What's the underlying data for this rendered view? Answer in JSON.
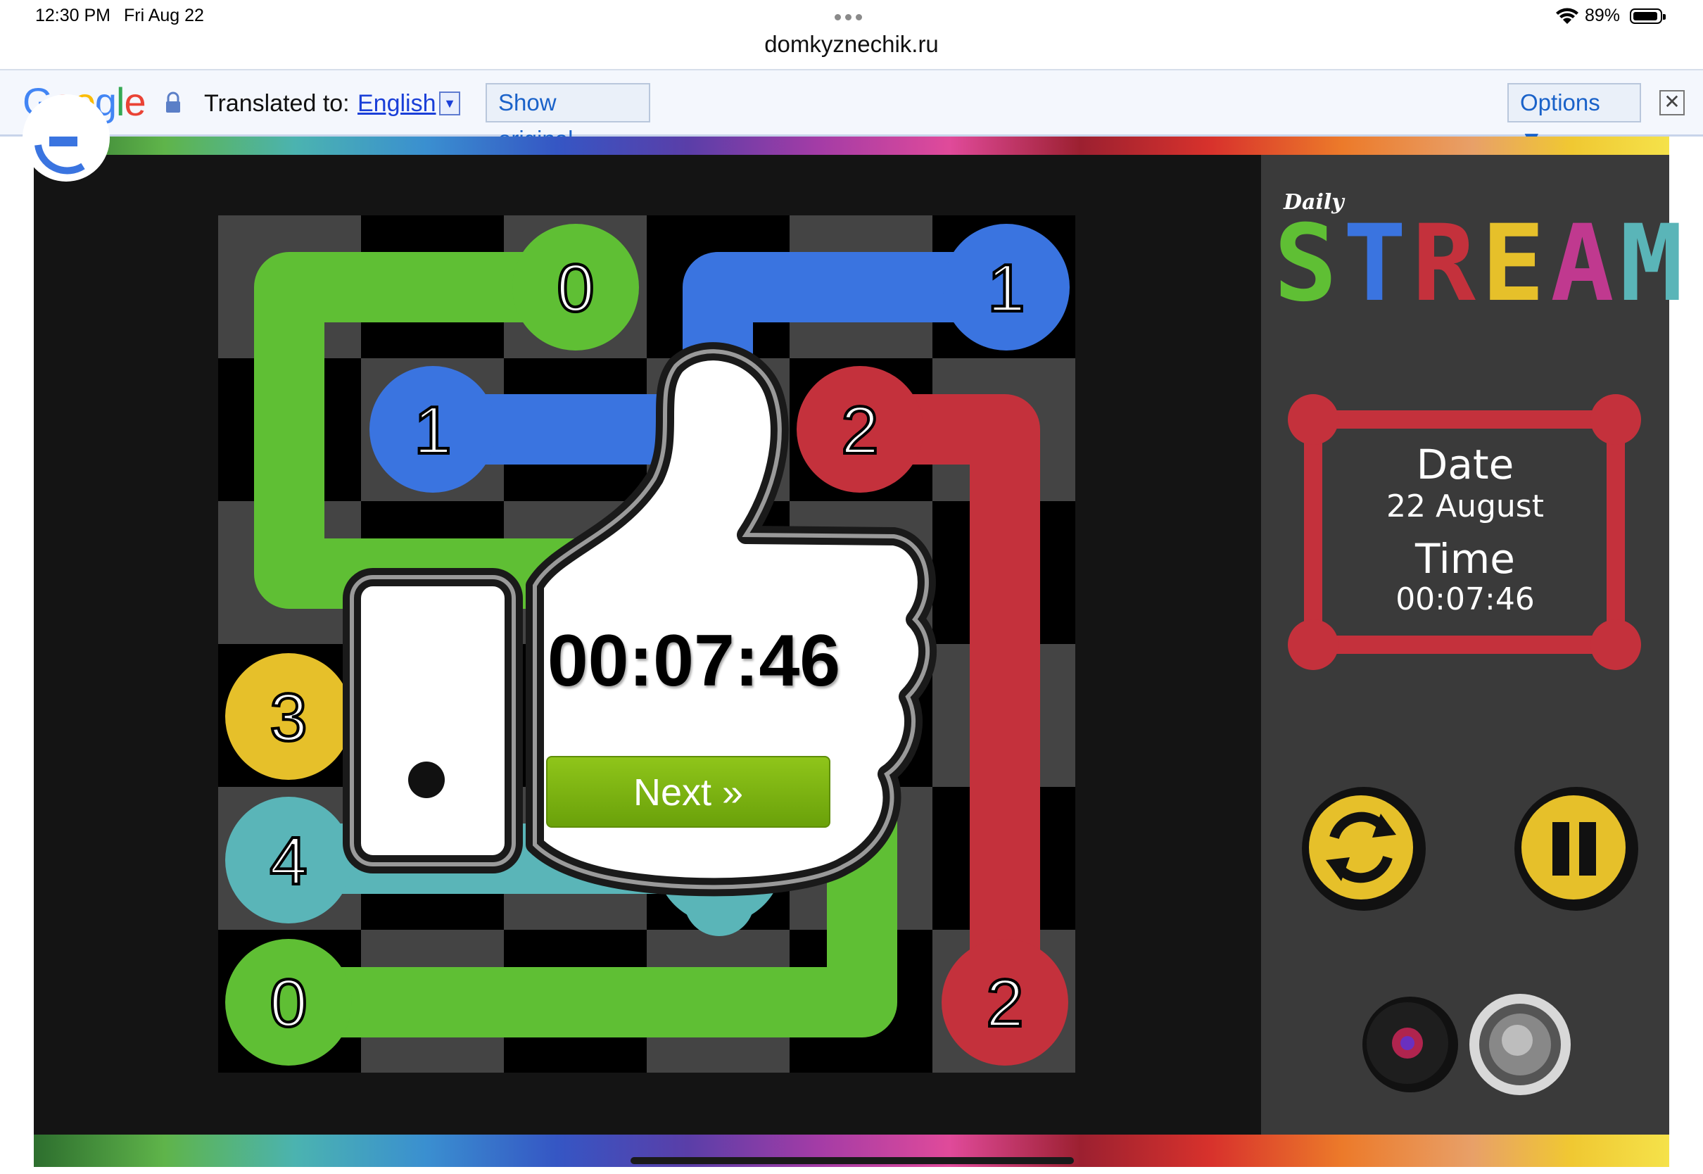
{
  "status_bar": {
    "time": "12:30 PM",
    "date": "Fri Aug 22",
    "battery": "89%"
  },
  "browser": {
    "url": "domkyznechik.ru"
  },
  "translate_bar": {
    "logo": "Google",
    "label": "Translated to:",
    "language": "English",
    "show_original": "Show original",
    "options": "Options ▼",
    "close": "✕"
  },
  "game": {
    "cells": [
      {
        "label": "0",
        "color": "#5fbf34"
      },
      {
        "label": "1",
        "color": "#3a74e0"
      },
      {
        "label": "1",
        "color": "#3a74e0"
      },
      {
        "label": "2",
        "color": "#c4313c"
      },
      {
        "label": "3",
        "color": "#e6c02a"
      },
      {
        "label": "4",
        "color": "#5ab5b8"
      },
      {
        "label": "0",
        "color": "#5fbf34"
      },
      {
        "label": "2",
        "color": "#c4313c"
      }
    ],
    "popup": {
      "timer": "00:07:46",
      "next_label": "Next »"
    }
  },
  "sidebar": {
    "logo_small": "Daily",
    "logo_letters": [
      {
        "ch": "S",
        "color": "#5fbf34"
      },
      {
        "ch": "T",
        "color": "#3a74e0"
      },
      {
        "ch": "R",
        "color": "#c4313c"
      },
      {
        "ch": "E",
        "color": "#e6c02a"
      },
      {
        "ch": "A",
        "color": "#c0398f"
      },
      {
        "ch": "M",
        "color": "#5ab5b8"
      }
    ],
    "date_heading": "Date",
    "date_value": "22 August",
    "time_heading": "Time",
    "time_value": "00:07:46"
  }
}
